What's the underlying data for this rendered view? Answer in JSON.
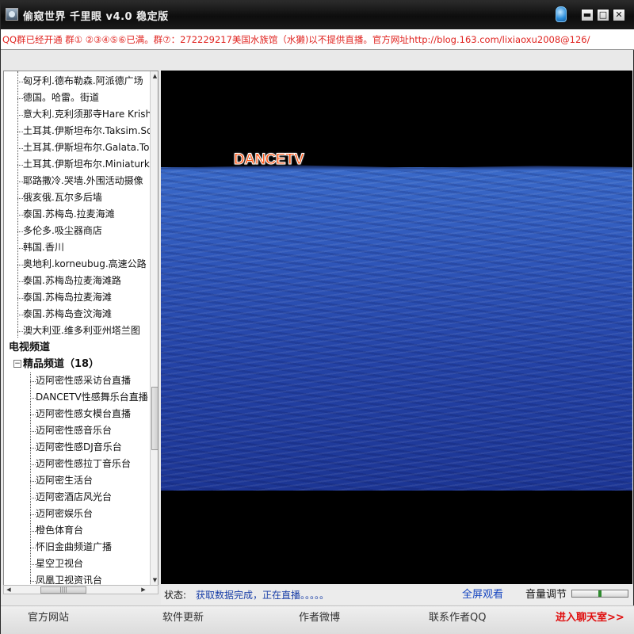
{
  "window": {
    "title": "偷窥世界 千里眼 v4.0 稳定版",
    "controls": {
      "minimize": "▬",
      "maximize": "□",
      "close": "✕"
    }
  },
  "marquee": {
    "text": "QQ群已经开通 群① ②③④⑤⑥已满。群⑦：272229217美国水族馆（水獭)以不提供直播。官方网址http://blog.163.com/lixiaoxu2008@126/"
  },
  "tree": {
    "places": [
      "匈牙利.德布勒森.阿派德广场",
      "德国。哈雷。街道",
      "意大利.克利须那寺Hare Krishna",
      "土耳其.伊斯坦布尔.Taksim.Square",
      "土耳其.伊斯坦布尔.Galata.Tower",
      "土耳其.伊斯坦布尔.Miniaturk",
      "耶路撒冷.哭墙.外围活动摄像",
      "俄亥俄.瓦尔多后墙",
      "泰国.苏梅岛.拉麦海滩",
      "多伦多.吸尘器商店",
      "韩国.香川",
      "奥地利.korneubug.高速公路",
      "泰国.苏梅岛拉麦海滩路",
      "泰国.苏梅岛拉麦海滩",
      "泰国.苏梅岛查汶海滩",
      "澳大利亚.维多利亚州塔兰图"
    ],
    "category": "电视频道",
    "subcategory": "精品频道（18）",
    "expand_symbol": "−",
    "channels": [
      "迈阿密性感采访台直播",
      "DANCETV性感舞乐台直播",
      "迈阿密性感女模台直播",
      "迈阿密性感音乐台",
      "迈阿密性感DJ音乐台",
      "迈阿密性感拉丁音乐台",
      "迈阿密生活台",
      "迈阿密酒店风光台",
      "迈阿密娱乐台",
      "橙色体育台",
      "怀旧金曲频道广播",
      "星空卫视台",
      "凤凰卫视资讯台"
    ],
    "scroll_up": "▲",
    "scroll_down": "▼",
    "scroll_left": "◀",
    "scroll_right": "▶",
    "grip": "||||"
  },
  "video": {
    "channel_logo": "DANCETV"
  },
  "status": {
    "label": "状态:",
    "text": "获取数据完成，正在直播。。。。。",
    "fullscreen": "全屏观看",
    "volume_label": "音量调节",
    "volume_level": 0.5
  },
  "bottom": {
    "site": "官方网站",
    "update": "软件更新",
    "weibo": "作者微博",
    "qq": "联系作者QQ",
    "chat": "进入聊天室>>"
  },
  "colors": {
    "marquee_text": "#e0231f",
    "status_text": "#1a3fa8",
    "chat_link": "#e00e0e",
    "video_bg": "#000000"
  }
}
